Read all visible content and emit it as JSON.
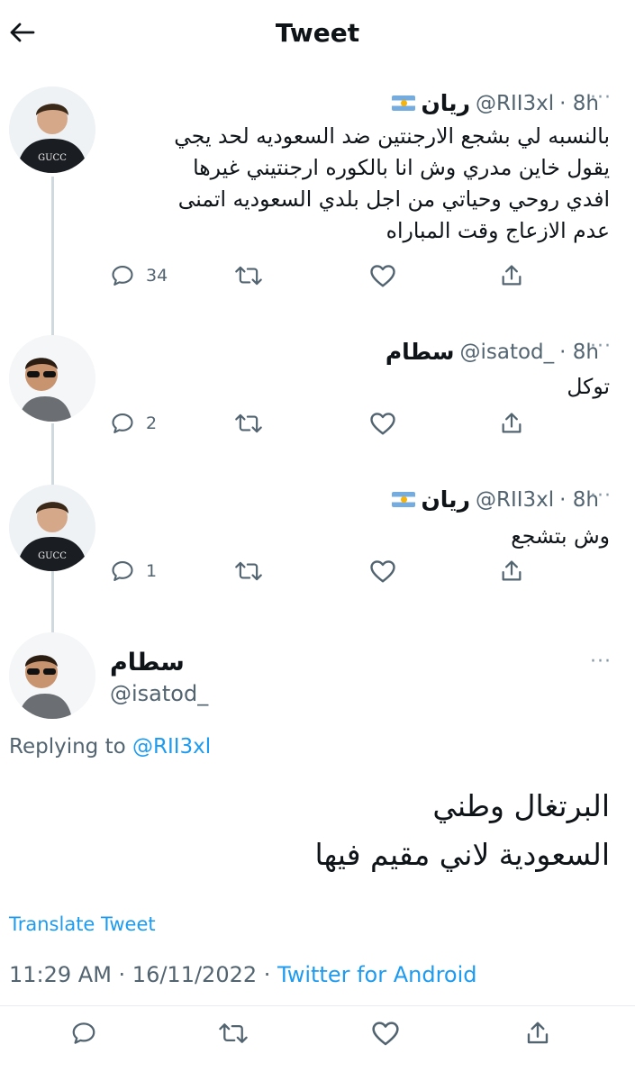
{
  "header": {
    "title": "Tweet"
  },
  "tweets": [
    {
      "name": "ريان",
      "handle": "@RII3xl",
      "time": "· 8h",
      "text": "بالنسبه لي بشجع الارجنتين ضد السعوديه لحد يجي\nيقول خاين مدري وش انا بالكوره ارجنتيني غيرها\nافدي روحي وحياتي من اجل بلدي السعوديه اتمنى\nعدم الازعاج وقت المباراه",
      "replies": "34",
      "avatar_icon": "gucci-hoodie-avatar"
    },
    {
      "name": "سطام",
      "handle": "@isatod_",
      "time": "· 8h",
      "text": "توكل",
      "replies": "2",
      "avatar_icon": "sunglasses-avatar"
    },
    {
      "name": "ريان",
      "handle": "@RII3xl",
      "time": "· 8h",
      "text": "وش بتشجع",
      "replies": "1",
      "avatar_icon": "gucci-hoodie-avatar"
    }
  ],
  "main_tweet": {
    "name": "سطام",
    "handle": "@isatod_",
    "replying_prefix": "Replying to ",
    "replying_to": "@RII3xl",
    "line1": "البرتغال وطني",
    "line2": "السعودية لاني مقيم فيها",
    "translate": "Translate Tweet",
    "time": "11:29 AM · 16/11/2022 · ",
    "client": "Twitter for Android"
  },
  "more_icon": "···",
  "colors": {
    "accent": "#1d9bf0",
    "muted": "#536471",
    "thread_line": "#cfd9de"
  }
}
